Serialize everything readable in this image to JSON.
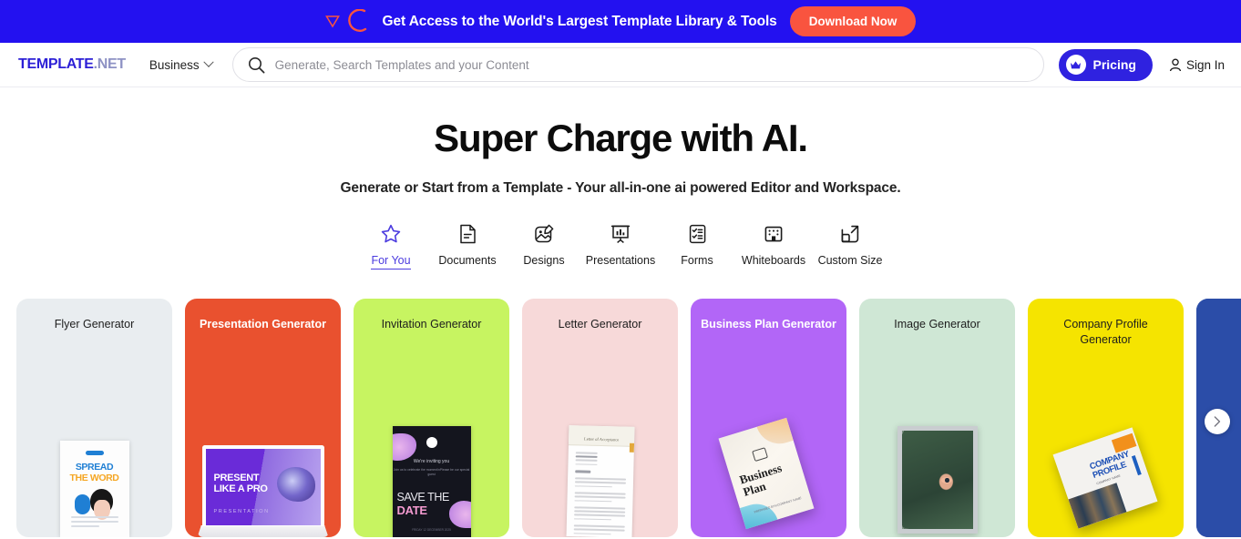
{
  "banner": {
    "text": "Get Access to the World's Largest Template Library & Tools",
    "cta_label": "Download Now",
    "bg_color": "#2311f0",
    "cta_color": "#f9543f",
    "icons": [
      "triangle-outline-icon",
      "arc-icon"
    ]
  },
  "header": {
    "logo_main": "TEMPLATE",
    "logo_suffix": ".NET",
    "workspace_label": "Business",
    "search_placeholder": "Generate, Search Templates and your Content",
    "search_value": "",
    "pricing_label": "Pricing",
    "signin_label": "Sign In",
    "accent_color": "#2f22e0"
  },
  "hero": {
    "title": "Super Charge with AI.",
    "subtitle": "Generate or Start from a Template - Your all-in-one ai powered Editor and Workspace."
  },
  "categories": [
    {
      "label": "For You",
      "icon": "star-icon",
      "active": true
    },
    {
      "label": "Documents",
      "icon": "document-icon",
      "active": false
    },
    {
      "label": "Designs",
      "icon": "image-edit-icon",
      "active": false
    },
    {
      "label": "Presentations",
      "icon": "presentation-icon",
      "active": false
    },
    {
      "label": "Forms",
      "icon": "checklist-icon",
      "active": false
    },
    {
      "label": "Whiteboards",
      "icon": "whiteboard-icon",
      "active": false
    },
    {
      "label": "Custom Size",
      "icon": "resize-icon",
      "active": false
    }
  ],
  "carousel": {
    "next_label": "›",
    "cards": [
      {
        "title": "Flyer Generator",
        "bg": "#e9edf0",
        "text_color": "#1d1d1d",
        "bold": false,
        "thumb": "flyer-spread-the-word"
      },
      {
        "title": "Presentation Generator",
        "bg": "#e9512f",
        "text_color": "#ffffff",
        "bold": true,
        "thumb": "laptop-present-like-a-pro"
      },
      {
        "title": "Invitation Generator",
        "bg": "#c7f461",
        "text_color": "#1d1d1d",
        "bold": false,
        "thumb": "invitation-save-the-date"
      },
      {
        "title": "Letter Generator",
        "bg": "#f7d9d9",
        "text_color": "#1d1d1d",
        "bold": false,
        "thumb": "letter-of-acceptance"
      },
      {
        "title": "Business Plan Generator",
        "bg": "#b266f7",
        "text_color": "#ffffff",
        "bold": true,
        "thumb": "business-plan-booklet"
      },
      {
        "title": "Image Generator",
        "bg": "#cfe7d5",
        "text_color": "#1d1d1d",
        "bold": false,
        "thumb": "framed-leaf-photo"
      },
      {
        "title": "Company Profile Generator",
        "bg": "#f5e400",
        "text_color": "#1d1d1d",
        "bold": false,
        "thumb": "company-profile-brochure"
      },
      {
        "title": "",
        "bg": "#2b4da8",
        "text_color": "#ffffff",
        "bold": false,
        "thumb": "partial-card"
      }
    ]
  },
  "flyer_thumb": {
    "line1": "SPREAD",
    "line2": "THE WORD"
  },
  "laptop_thumb": {
    "line1": "PRESENT",
    "line2": "LIKE A PRO",
    "caption": "PRESENTATION"
  },
  "invite_thumb": {
    "small": "We're inviting you",
    "sub": "Join us to celebrate the moment\\nPlease be our special guest",
    "save": "SAVE THE",
    "date": "DATE",
    "footer": "FRIDAY 12 DECEMBER 2025"
  },
  "letter_thumb": {
    "title": "Letter of Acceptance"
  },
  "bplan_thumb": {
    "line1": "Business",
    "line2": "Plan",
    "sub": "PREPARED BY\\nCOMPANY NAME"
  },
  "cprofile_thumb": {
    "line1": "COMPANY",
    "line2": "PROFILE",
    "sub": "COMPANY NAME"
  }
}
